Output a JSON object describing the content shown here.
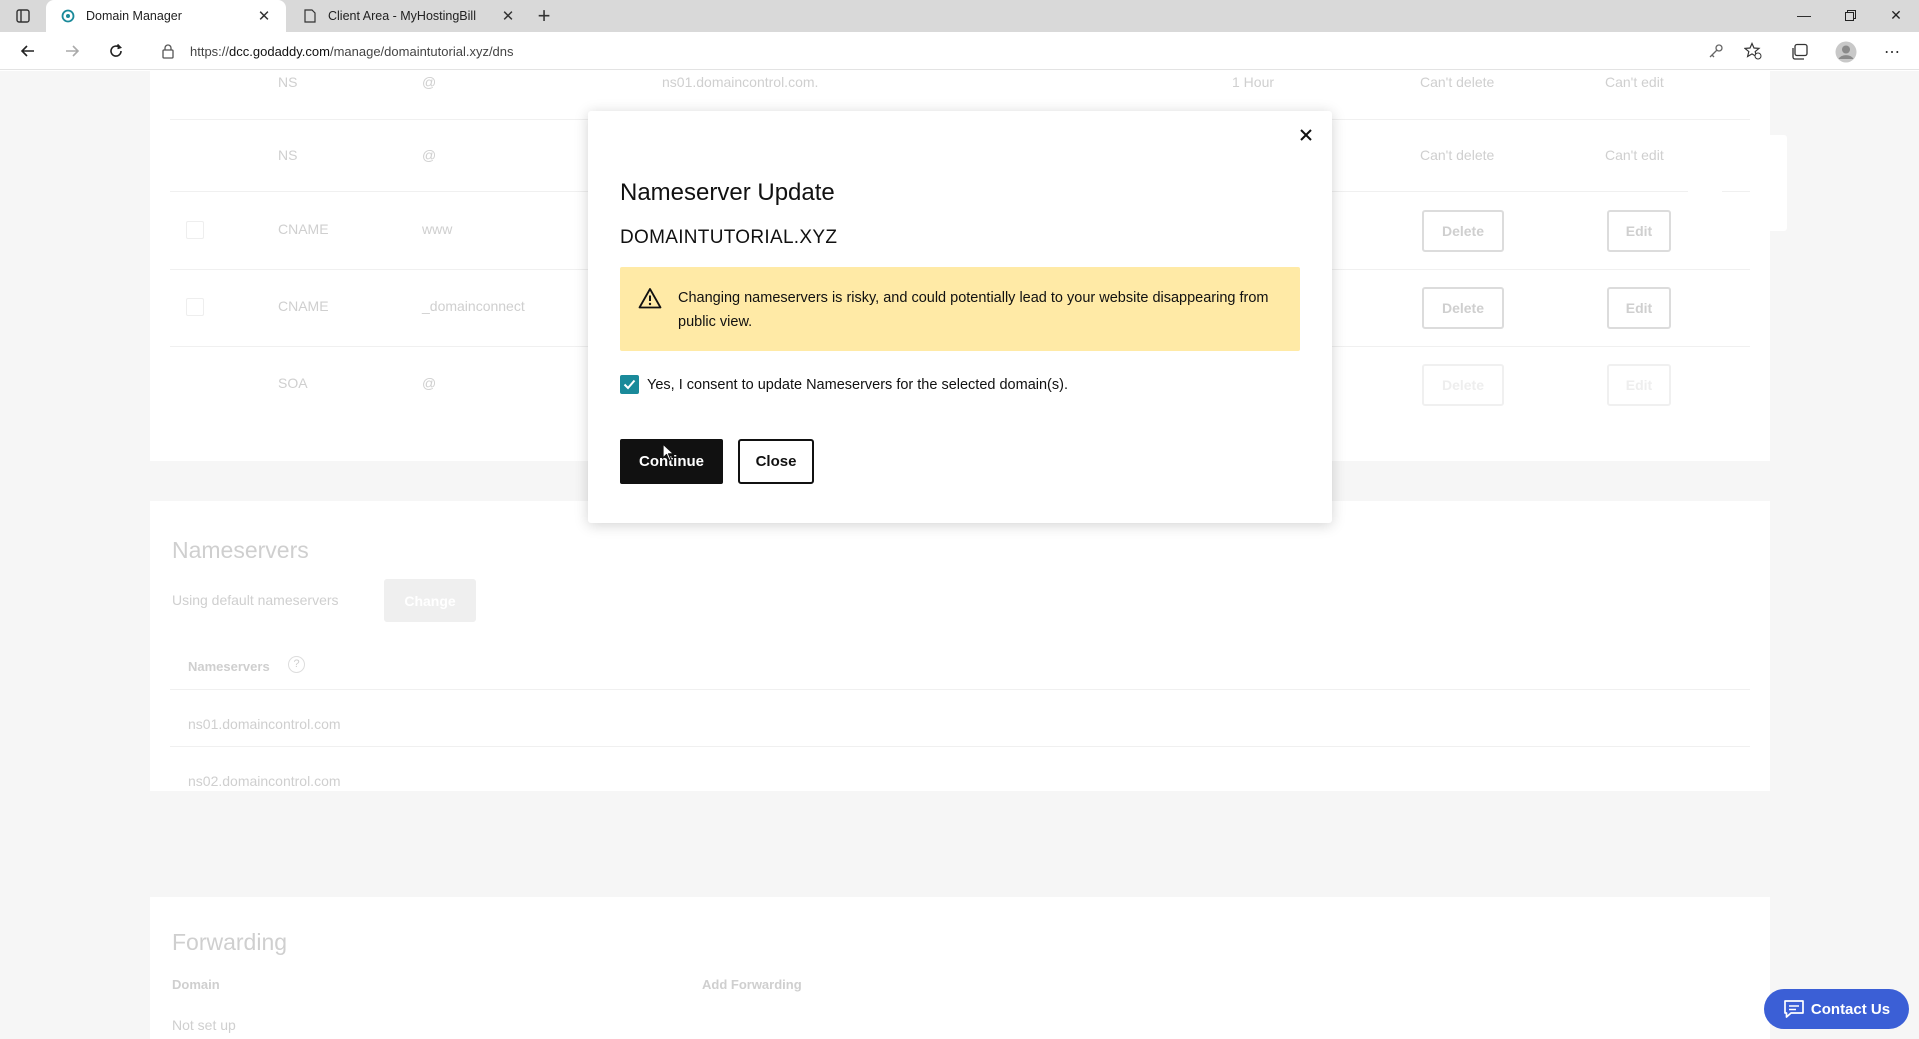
{
  "browser": {
    "tabs": [
      {
        "title": "Domain Manager",
        "active": true,
        "favicon": "godaddy-icon"
      },
      {
        "title": "Client Area - MyHostingBill",
        "active": false,
        "favicon": "page-icon"
      }
    ],
    "url_prefix": "https://",
    "url_host": "dcc.godaddy.com",
    "url_path": "/manage/domaintutorial.xyz/dns"
  },
  "background": {
    "dns_rows": [
      {
        "type": "NS",
        "name": "@",
        "value": "ns01.domaincontrol.com.",
        "ttl": "1 Hour",
        "delete": "Can't delete",
        "edit": "Can't edit"
      },
      {
        "type": "NS",
        "name": "@",
        "value": "",
        "ttl": "",
        "delete": "Can't delete",
        "edit": "Can't edit"
      },
      {
        "type": "CNAME",
        "name": "www",
        "value": "",
        "ttl": "",
        "delete": "Delete",
        "edit": "Edit"
      },
      {
        "type": "CNAME",
        "name": "_domainconnect",
        "value": "",
        "ttl": "",
        "delete": "Delete",
        "edit": "Edit"
      },
      {
        "type": "SOA",
        "name": "@",
        "value": "",
        "ttl": "",
        "delete": "Delete",
        "edit": "Edit"
      }
    ],
    "nameservers": {
      "heading": "Nameservers",
      "status": "Using default nameservers",
      "change_label": "Change",
      "column_label": "Nameservers",
      "items": [
        "ns01.domaincontrol.com",
        "ns02.domaincontrol.com"
      ]
    },
    "forwarding": {
      "heading": "Forwarding",
      "domain_label": "Domain",
      "add_label": "Add Forwarding",
      "not_set": "Not set up"
    }
  },
  "modal": {
    "title": "Nameserver Update",
    "domain": "DOMAINTUTORIAL.XYZ",
    "warning": "Changing nameservers is risky, and could potentially lead to your website disappearing from public view.",
    "consent_label": "Yes, I consent to update Nameservers for the selected domain(s).",
    "consent_checked": true,
    "continue_label": "Continue",
    "close_label": "Close"
  },
  "contact": {
    "label": "Contact Us"
  },
  "colors": {
    "accent_teal": "#1a8a9a",
    "warning_bg": "#ffeaa6",
    "contact_blue": "#3b5fd6",
    "primary_black": "#111111"
  }
}
